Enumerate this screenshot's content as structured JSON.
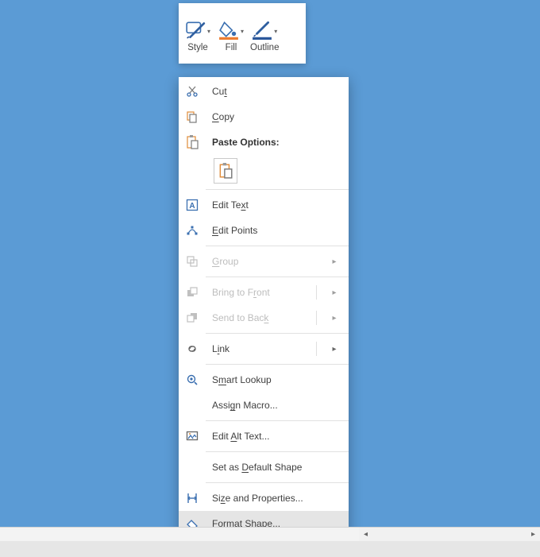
{
  "toolbar": {
    "style_label": "Style",
    "fill_label": "Fill",
    "outline_label": "Outline"
  },
  "menu": {
    "cut": "Cut",
    "copy": "Copy",
    "paste_options": "Paste Options:",
    "edit_text": "Edit Text",
    "edit_points": "Edit Points",
    "group": "Group",
    "bring_front": "Bring to Front",
    "send_back": "Send to Back",
    "link": "Link",
    "smart_lookup": "Smart Lookup",
    "assign_macro": "Assign Macro...",
    "edit_alt_text": "Edit Alt Text...",
    "set_default": "Set as Default Shape",
    "size_props": "Size and Properties...",
    "format_shape": "Format Shape..."
  }
}
